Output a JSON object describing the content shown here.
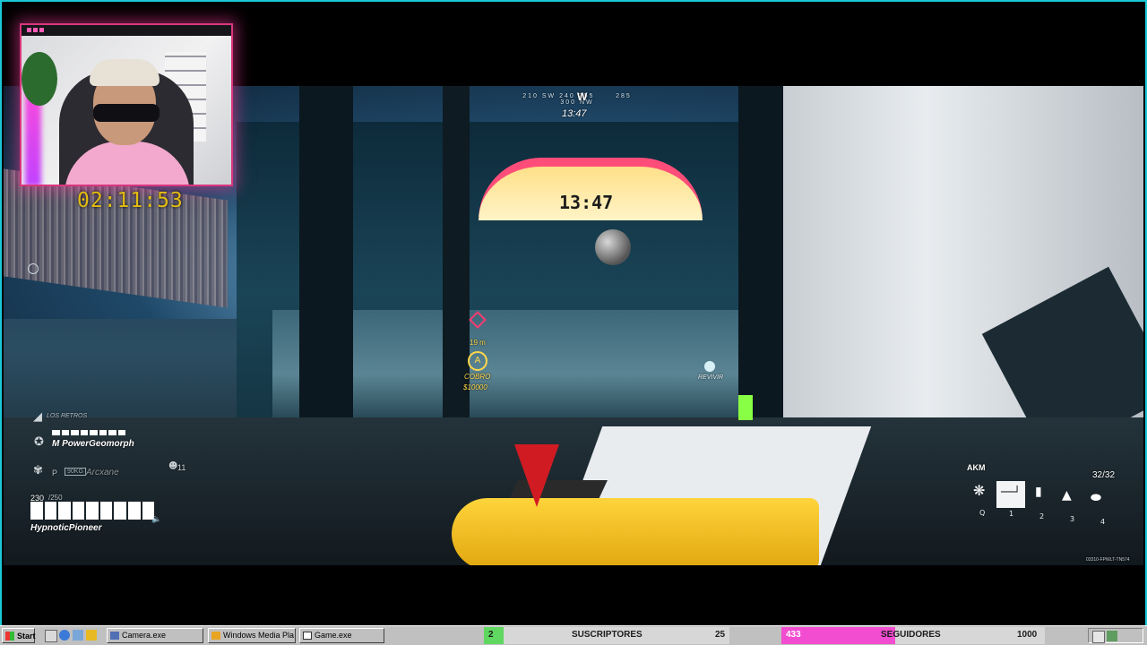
{
  "overlay": {
    "timer": "02:11:53",
    "accent_color": "#1ac8d8"
  },
  "hud": {
    "compass": {
      "left_ticks": "210  SW  240  255",
      "heading": "W",
      "right_ticks": "285  300  NW"
    },
    "match_time": "13:47",
    "arena_screen": "13:47",
    "squad": {
      "name": "LOS RETROS",
      "teammate1": "M PowerGeomorph",
      "teammate2_prefix": "P",
      "teammate2_tag": "90KG",
      "teammate2": "Arcxane",
      "kills": "11"
    },
    "player": {
      "hp": "230",
      "hp_max": "/250",
      "name": "HypnoticPioneer"
    },
    "weapon": {
      "name": "AKM",
      "ammo": "32/32",
      "gadget_key": "Q",
      "slots": [
        "1",
        "2",
        "3",
        "4"
      ]
    },
    "objective": {
      "distance": "19 m",
      "label": "A",
      "title": "COBRO",
      "reward": "$10000"
    },
    "revive": "REVIVIR",
    "build_code": "03310-FPWLT-TN574"
  },
  "taskbar": {
    "start_label": "Start",
    "buttons": [
      "Camera.exe",
      "Windows Media Pla",
      "Game.exe"
    ],
    "subscribers": {
      "label": "SUSCRIPTORES",
      "current": "2",
      "goal": "25",
      "progress": 0.08,
      "color": "#5fd760"
    },
    "followers": {
      "label": "SEGUIDORES",
      "current": "433",
      "goal": "1000",
      "progress": 0.433,
      "color": "#f24cd0"
    }
  }
}
